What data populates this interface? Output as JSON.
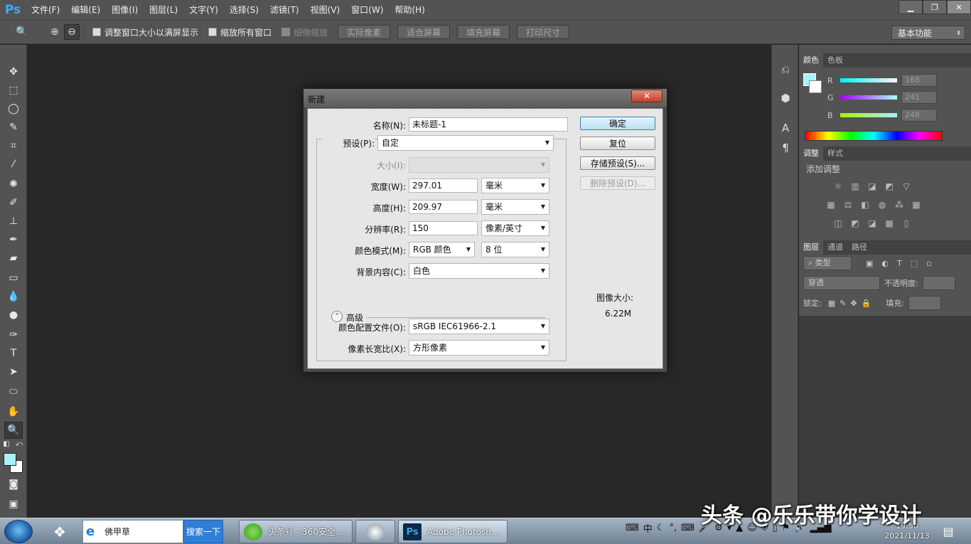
{
  "menubar": {
    "logo": "Ps",
    "items": [
      "文件(F)",
      "编辑(E)",
      "图像(I)",
      "图层(L)",
      "文字(Y)",
      "选择(S)",
      "滤镜(T)",
      "视图(V)",
      "窗口(W)",
      "帮助(H)"
    ]
  },
  "optbar": {
    "check_resize_window": "调整窗口大小以满屏显示",
    "check_zoom_all": "缩放所有窗口",
    "check_scrubby": "细微缩放",
    "btn_actual": "实际像素",
    "btn_fit": "适合屏幕",
    "btn_fill": "填充屏幕",
    "btn_print": "打印尺寸",
    "workspace": "基本功能"
  },
  "panels": {
    "color_tabs": [
      "颜色",
      "色板"
    ],
    "color_r_label": "R",
    "color_g_label": "G",
    "color_b_label": "B",
    "color_r": "168",
    "color_g": "241",
    "color_b": "248",
    "adjust_tabs": [
      "调整",
      "样式"
    ],
    "adjust_title": "添加调整",
    "layers_tabs": [
      "图层",
      "通道",
      "路径"
    ],
    "layers_filter": "类型",
    "blend_mode": "穿透",
    "opacity_label": "不透明度:",
    "lock_label": "锁定:",
    "fill_label": "填充:"
  },
  "dialog": {
    "title": "新建",
    "name_label": "名称(N):",
    "name_value": "未标题-1",
    "preset_label": "预设(P):",
    "preset_value": "自定",
    "size_label": "大小(I):",
    "width_label": "宽度(W):",
    "width_value": "297.01",
    "width_unit": "毫米",
    "height_label": "高度(H):",
    "height_value": "209.97",
    "height_unit": "毫米",
    "resolution_label": "分辨率(R):",
    "resolution_value": "150",
    "resolution_unit": "像素/英寸",
    "color_mode_label": "颜色模式(M):",
    "color_mode_value": "RGB 颜色",
    "bit_depth_value": "8 位",
    "background_label": "背景内容(C):",
    "background_value": "白色",
    "advanced_label": "高级",
    "profile_label": "颜色配置文件(O):",
    "profile_value": "sRGB IEC61966-2.1",
    "aspect_label": "像素长宽比(X):",
    "aspect_value": "方形像素",
    "ok_button": "确定",
    "reset_button": "复位",
    "save_preset_button": "存储预设(S)...",
    "delete_preset_button": "删除预设(D)...",
    "image_size_label": "图像大小:",
    "image_size_value": "6.22M"
  },
  "taskbar": {
    "ie_text": "佛甲草",
    "search_button": "搜索一下",
    "app1": "头条号 - 360安全...",
    "app2": "Adobe Photosh...",
    "clock_time": "19:50",
    "clock_date": "2021/11/13",
    "tray_ime": "中"
  },
  "watermark": "头条 @乐乐带你学设计",
  "colors": {
    "foreground": "#a8f1f8",
    "background": "#ffffff",
    "ps_blue": "#3fa9f5"
  }
}
